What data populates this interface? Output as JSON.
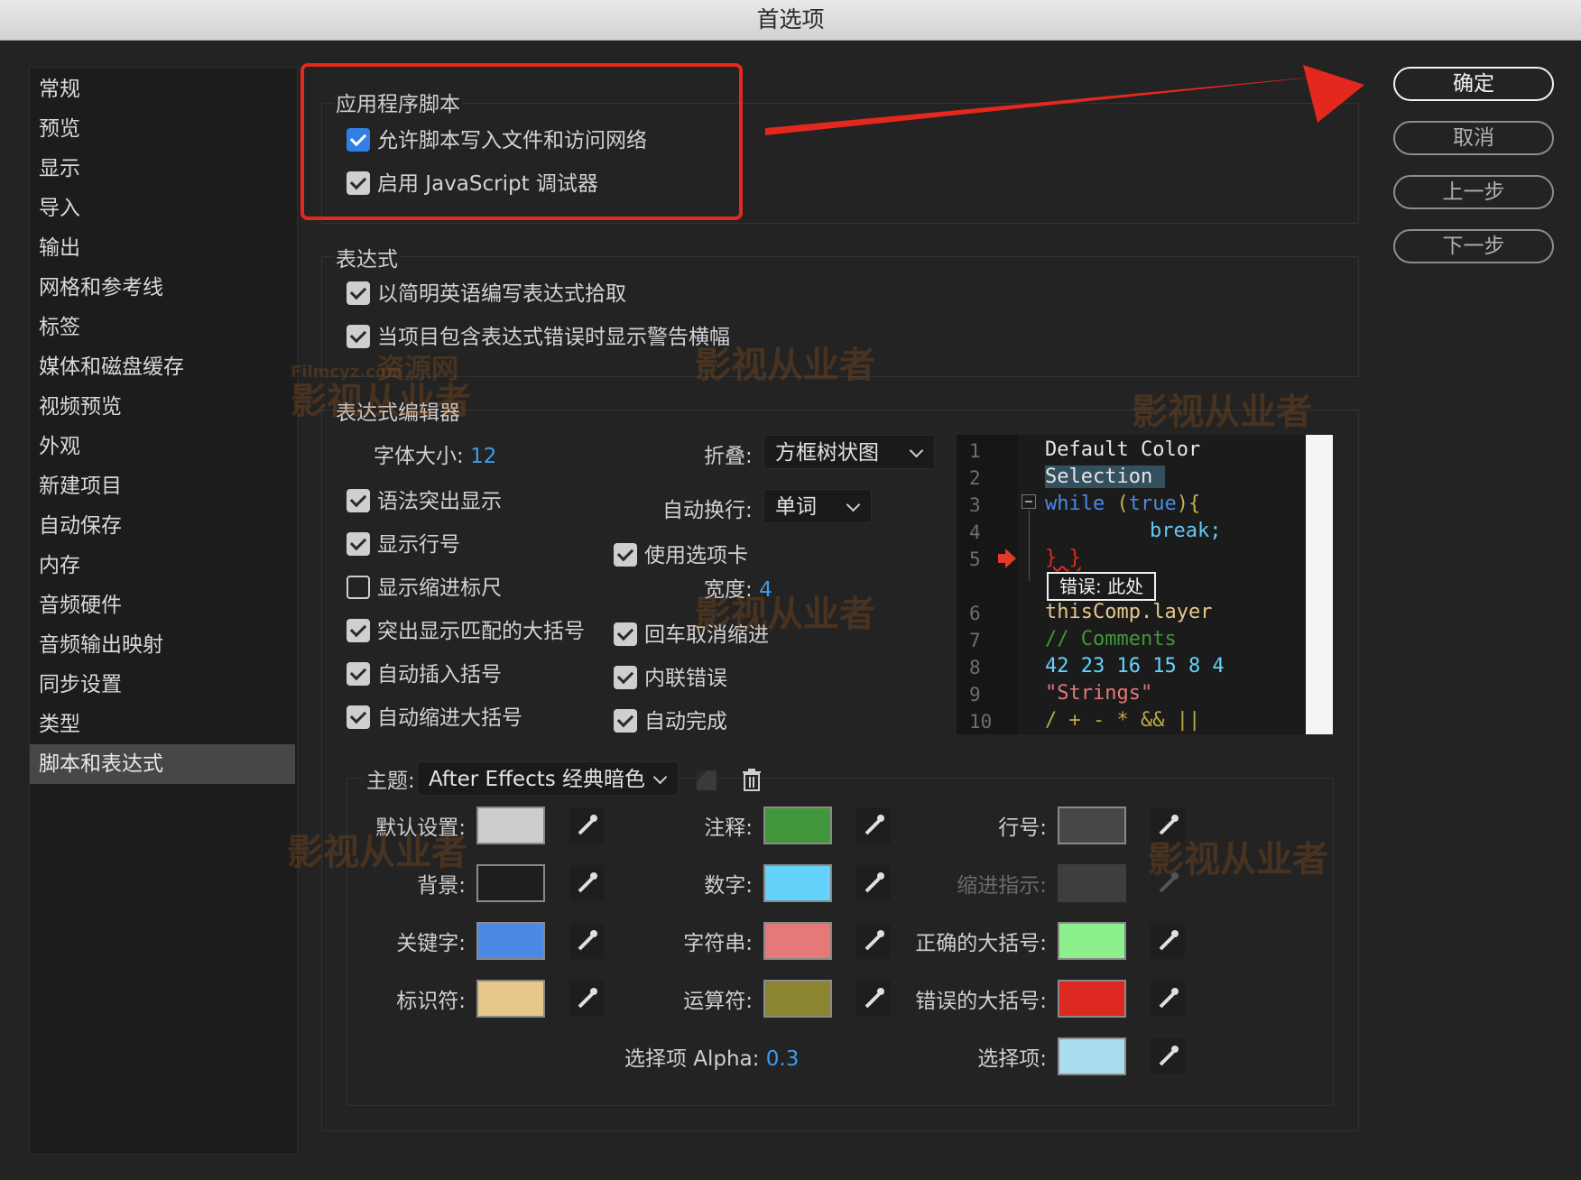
{
  "window": {
    "title": "首选项"
  },
  "sidebar": {
    "items": [
      "常规",
      "预览",
      "显示",
      "导入",
      "输出",
      "网格和参考线",
      "标签",
      "媒体和磁盘缓存",
      "视频预览",
      "外观",
      "新建项目",
      "自动保存",
      "内存",
      "音频硬件",
      "音频输出映射",
      "同步设置",
      "类型",
      "脚本和表达式"
    ],
    "selected": "脚本和表达式"
  },
  "buttons": {
    "ok": "确定",
    "cancel": "取消",
    "prev": "上一步",
    "next": "下一步"
  },
  "app_scripts": {
    "title": "应用程序脚本",
    "allow_write": {
      "label": "允许脚本写入文件和访问网络",
      "checked": true
    },
    "js_debugger": {
      "label": "启用 JavaScript 调试器",
      "checked": true
    }
  },
  "expressions": {
    "title": "表达式",
    "plain_english": {
      "label": "以简明英语编写表达式拾取",
      "checked": true
    },
    "warning_banner": {
      "label": "当项目包含表达式错误时显示警告横幅",
      "checked": true
    }
  },
  "expression_editor": {
    "title": "表达式编辑器",
    "font_size_label": "字体大小:",
    "font_size_value": "12",
    "fold_label": "折叠:",
    "fold_value": "方框树状图",
    "wrap_label": "自动换行:",
    "wrap_value": "单词",
    "syntax_highlight": {
      "label": "语法突出显示",
      "checked": true
    },
    "line_numbers": {
      "label": "显示行号",
      "checked": true
    },
    "indent_guides": {
      "label": "显示缩进标尺",
      "checked": false
    },
    "match_brackets": {
      "label": "突出显示匹配的大括号",
      "checked": true
    },
    "auto_brackets": {
      "label": "自动插入括号",
      "checked": true
    },
    "auto_indent": {
      "label": "自动缩进大括号",
      "checked": true
    },
    "use_tabs": {
      "label": "使用选项卡",
      "checked": true
    },
    "tab_width_label": "宽度:",
    "tab_width_value": "4",
    "return_unindent": {
      "label": "回车取消缩进",
      "checked": true
    },
    "inline_errors": {
      "label": "内联错误",
      "checked": true
    },
    "autocomplete": {
      "label": "自动完成",
      "checked": true
    },
    "theme_label": "主题:",
    "theme_value": "After Effects 经典暗色"
  },
  "code_preview": {
    "line_numbers": [
      "1",
      "2",
      "3",
      "4",
      "5",
      "6",
      "7",
      "8",
      "9",
      "10"
    ],
    "line1": "Default Color",
    "line2": "Selection",
    "line3_kw": "while",
    "line3_paren_open": " (",
    "line3_true": "true",
    "line3_rest": "){",
    "line4": "break;",
    "line5": "} }",
    "error_tip": "错误: 此处",
    "line6": "thisComp.layer",
    "line7": "// Comments",
    "line8": "42 23 16 15 8 4",
    "line9": "\"Strings\"",
    "line10": "/ + - * && ||"
  },
  "colors": {
    "default": {
      "label": "默认设置:",
      "hex": "#cccccc"
    },
    "background": {
      "label": "背景:",
      "hex": "#1e1e1e"
    },
    "keyword": {
      "label": "关键字:",
      "hex": "#4a8ae6"
    },
    "identifier": {
      "label": "标识符:",
      "hex": "#e6c88c"
    },
    "comment": {
      "label": "注释:",
      "hex": "#42963c"
    },
    "number": {
      "label": "数字:",
      "hex": "#64d2fa"
    },
    "string": {
      "label": "字符串:",
      "hex": "#e67878"
    },
    "operator": {
      "label": "运算符:",
      "hex": "#8c8632"
    },
    "line_number": {
      "label": "行号:",
      "hex": "#474747"
    },
    "indent_guide": {
      "label": "缩进指示:",
      "hex": "#3e3e3e"
    },
    "valid_bracket": {
      "label": "正确的大括号:",
      "hex": "#8cf08c"
    },
    "invalid_bracket": {
      "label": "错误的大括号:",
      "hex": "#dc2820"
    },
    "selection": {
      "label": "选择项:",
      "hex": "#aadcf0"
    },
    "selection_alpha_label": "选择项 Alpha:",
    "selection_alpha_value": "0.3"
  },
  "watermarks": [
    "Filmcyz.com",
    "资源网",
    "影视从业者"
  ]
}
